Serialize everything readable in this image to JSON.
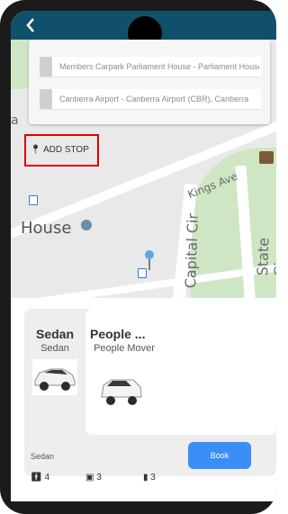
{
  "header": {
    "back_label": "<"
  },
  "route": {
    "from": "Members Carpark Parliament House - Parliament House",
    "to": "Canberra Airport - Canberra Airport (CBR), Canberra"
  },
  "add_stop_label": "ADD STOP",
  "map": {
    "labels": [
      "Kings Ave",
      "Capital Cir",
      "State Cir",
      "House",
      "a"
    ],
    "house_label": "House"
  },
  "vehicles": [
    {
      "name": "Sedan",
      "type": "Sedan"
    },
    {
      "name": "People ...",
      "type": "People Mover"
    }
  ],
  "selected": {
    "label": "Sedan",
    "passengers": "4",
    "large_bags": "3",
    "small_bags": "3"
  },
  "book_label": "Book",
  "colors": {
    "topbar": "#11506a",
    "book": "#3a8ef6",
    "highlight": "#e00000"
  }
}
